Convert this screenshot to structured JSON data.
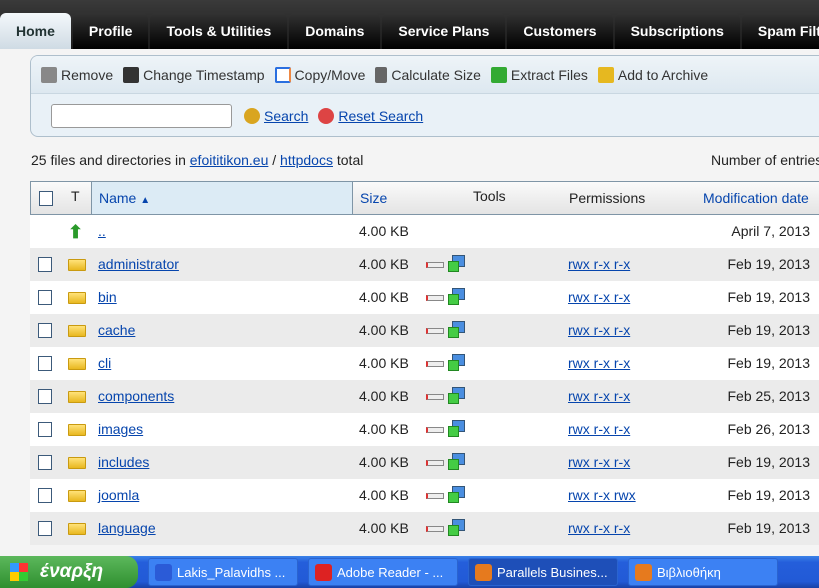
{
  "tabs": [
    "Home",
    "Profile",
    "Tools & Utilities",
    "Domains",
    "Service Plans",
    "Customers",
    "Subscriptions",
    "Spam Filter"
  ],
  "toolbar": {
    "remove": "Remove",
    "timestamp": "Change Timestamp",
    "copy": "Copy/Move",
    "calc": "Calculate Size",
    "extract": "Extract Files",
    "archive": "Add to Archive"
  },
  "search": {
    "value": "",
    "button": "Search",
    "reset": "Reset Search"
  },
  "info": {
    "prefix": "25 files and directories in",
    "domain": "efoititikon.eu",
    "sep": "/",
    "dir": "httpdocs",
    "suffix": "total",
    "entries": "Number of entries"
  },
  "columns": {
    "type": "T",
    "name": "Name",
    "size": "Size",
    "tools": "Tools",
    "perms": "Permissions",
    "date": "Modification date"
  },
  "parent": {
    "name": "..",
    "size": "4.00 KB",
    "date": "April 7, 2013"
  },
  "rows": [
    {
      "name": "administrator",
      "size": "4.00 KB",
      "perms": "rwx r-x r-x",
      "date": "Feb 19, 2013"
    },
    {
      "name": "bin",
      "size": "4.00 KB",
      "perms": "rwx r-x r-x",
      "date": "Feb 19, 2013"
    },
    {
      "name": "cache",
      "size": "4.00 KB",
      "perms": "rwx r-x r-x",
      "date": "Feb 19, 2013"
    },
    {
      "name": "cli",
      "size": "4.00 KB",
      "perms": "rwx r-x r-x",
      "date": "Feb 19, 2013"
    },
    {
      "name": "components",
      "size": "4.00 KB",
      "perms": "rwx r-x r-x",
      "date": "Feb 25, 2013"
    },
    {
      "name": "images",
      "size": "4.00 KB",
      "perms": "rwx r-x r-x",
      "date": "Feb 26, 2013"
    },
    {
      "name": "includes",
      "size": "4.00 KB",
      "perms": "rwx r-x r-x",
      "date": "Feb 19, 2013"
    },
    {
      "name": "joomla",
      "size": "4.00 KB",
      "perms": "rwx r-x rwx",
      "date": "Feb 19, 2013"
    },
    {
      "name": "language",
      "size": "4.00 KB",
      "perms": "rwx r-x r-x",
      "date": "Feb 19, 2013"
    }
  ],
  "taskbar": {
    "start": "έναρξη",
    "items": [
      "Lakis_Palavidhs ...",
      "Adobe Reader - ...",
      "Parallels Busines...",
      "Βιβλιοθήκη"
    ]
  }
}
